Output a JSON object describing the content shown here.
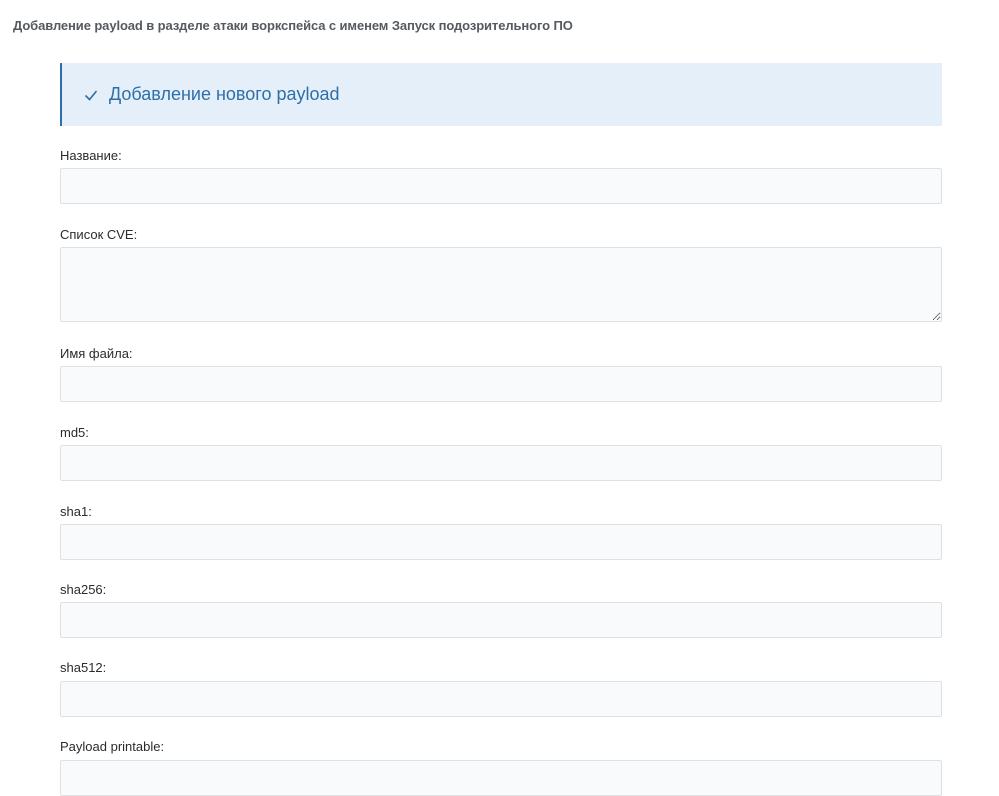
{
  "page": {
    "title": "Добавление payload в разделе атаки воркспейса с именем Запуск подозрительного ПО"
  },
  "section": {
    "title": "Добавление нового payload",
    "icon": "check-icon",
    "accent_color": "#2f6fa8",
    "background_color": "#e4eff9"
  },
  "fields": {
    "name": {
      "label": "Название:",
      "value": "",
      "placeholder": ""
    },
    "cve_list": {
      "label": "Список CVE:",
      "value": "",
      "placeholder": ""
    },
    "file_name": {
      "label": "Имя файла:",
      "value": "",
      "placeholder": ""
    },
    "md5": {
      "label": "md5:",
      "value": "",
      "placeholder": ""
    },
    "sha1": {
      "label": "sha1:",
      "value": "",
      "placeholder": ""
    },
    "sha256": {
      "label": "sha256:",
      "value": "",
      "placeholder": ""
    },
    "sha512": {
      "label": "sha512:",
      "value": "",
      "placeholder": ""
    },
    "payload_printable": {
      "label": "Payload printable:",
      "value": "",
      "placeholder": ""
    }
  }
}
